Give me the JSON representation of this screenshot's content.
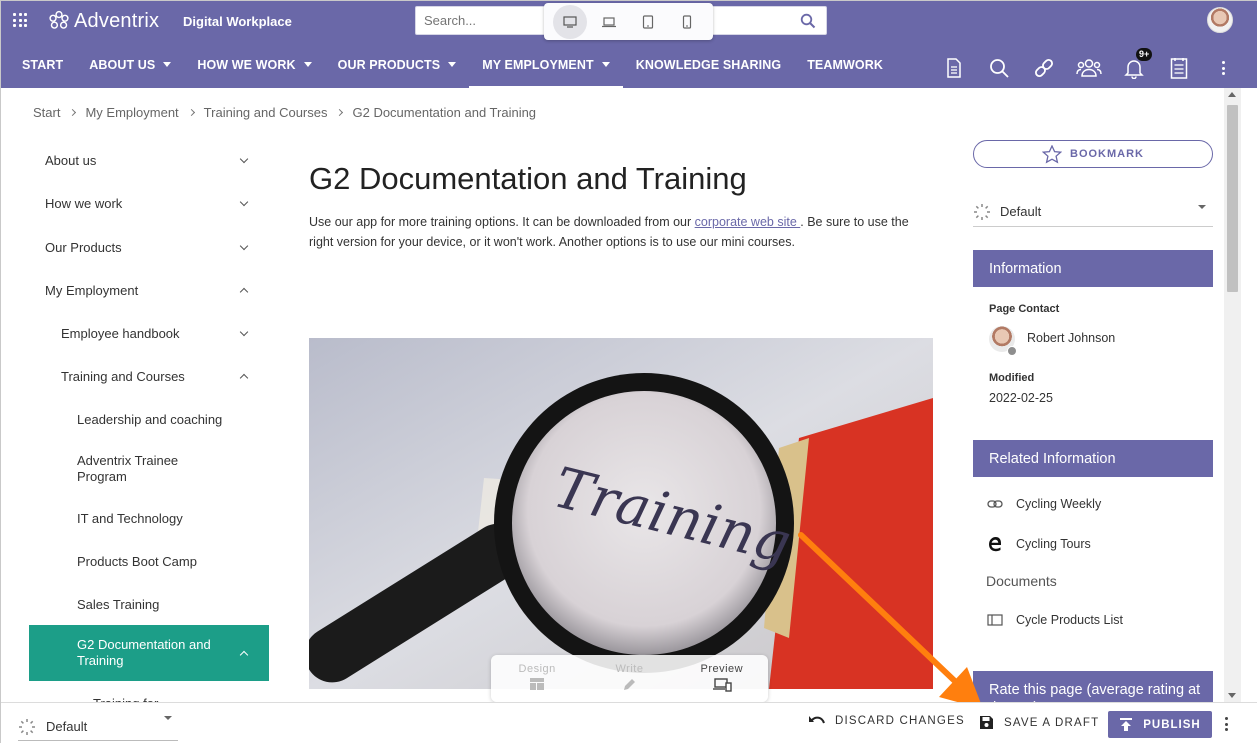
{
  "header": {
    "logo_text": "Adventrix",
    "site_title": "Digital Workplace",
    "search_placeholder": "Search...",
    "device_modes": [
      "desktop",
      "laptop",
      "tablet",
      "phone"
    ],
    "notification_count": "9+"
  },
  "nav": {
    "items": [
      {
        "label": "START",
        "dropdown": false
      },
      {
        "label": "ABOUT US",
        "dropdown": true
      },
      {
        "label": "HOW WE WORK",
        "dropdown": true
      },
      {
        "label": "OUR PRODUCTS",
        "dropdown": true
      },
      {
        "label": "MY EMPLOYMENT",
        "dropdown": true,
        "active": true
      },
      {
        "label": "KNOWLEDGE SHARING",
        "dropdown": false
      },
      {
        "label": "TEAMWORK",
        "dropdown": false
      }
    ],
    "icons": [
      "document-icon",
      "search-icon",
      "link-icon",
      "people-icon",
      "bell-icon",
      "checklist-icon",
      "more-vertical-icon"
    ]
  },
  "breadcrumb": [
    "Start",
    "My Employment",
    "Training and Courses",
    "G2 Documentation and Training"
  ],
  "leftnav": {
    "items": [
      {
        "label": "About us",
        "level": 0,
        "state": "collapsed"
      },
      {
        "label": "How we work",
        "level": 0,
        "state": "collapsed"
      },
      {
        "label": "Our Products",
        "level": 0,
        "state": "collapsed"
      },
      {
        "label": "My Employment",
        "level": 0,
        "state": "expanded"
      },
      {
        "label": "Employee handbook",
        "level": 1,
        "state": "collapsed"
      },
      {
        "label": "Training and Courses",
        "level": 1,
        "state": "expanded"
      },
      {
        "label": "Leadership and coaching",
        "level": 2,
        "state": "none"
      },
      {
        "label": "Adventrix Trainee Program",
        "level": 2,
        "state": "none"
      },
      {
        "label": "IT and Technology",
        "level": 2,
        "state": "none"
      },
      {
        "label": "Products Boot Camp",
        "level": 2,
        "state": "none"
      },
      {
        "label": "Sales Training",
        "level": 2,
        "state": "none"
      },
      {
        "label": "G2 Documentation and Training",
        "level": 2,
        "state": "expanded",
        "selected": true
      },
      {
        "label": "Training for",
        "level": 3,
        "state": "none"
      }
    ]
  },
  "main": {
    "title": "G2 Documentation and Training",
    "intro_before_link": "Use our app for more training options. It can be downloaded from our ",
    "intro_link": "corporate web site ",
    "intro_after_link": ". Be sure to use the right version for your device, or it won't work. Another options is to use our mini courses.",
    "image_word": "Training",
    "mode_switch": {
      "design": "Design",
      "write": "Write",
      "preview": "Preview",
      "active": "preview"
    }
  },
  "right": {
    "bookmark_label": "BOOKMARK",
    "language_value": "Default",
    "information": {
      "heading": "Information",
      "contact_label": "Page Contact",
      "contact_name": "Robert Johnson",
      "modified_label": "Modified",
      "modified_value": "2022-02-25"
    },
    "related": {
      "heading": "Related Information",
      "items": [
        {
          "label": "Cycling Weekly",
          "icon": "link-icon"
        },
        {
          "label": "Cycling Tours",
          "icon": "edge-browser-icon"
        }
      ],
      "documents_heading": "Documents",
      "documents": [
        {
          "label": "Cycle Products List",
          "icon": "list-view-icon"
        }
      ]
    },
    "rate_heading": "Rate this page (average rating at the top)"
  },
  "bottombar": {
    "language_value": "Default",
    "discard_label": "DISCARD CHANGES",
    "draft_label": "SAVE A DRAFT",
    "publish_label": "PUBLISH"
  },
  "colors": {
    "brand": "#6a68a8",
    "selected_nav": "#1c9e88",
    "annotation_arrow": "#ff7f0e"
  }
}
